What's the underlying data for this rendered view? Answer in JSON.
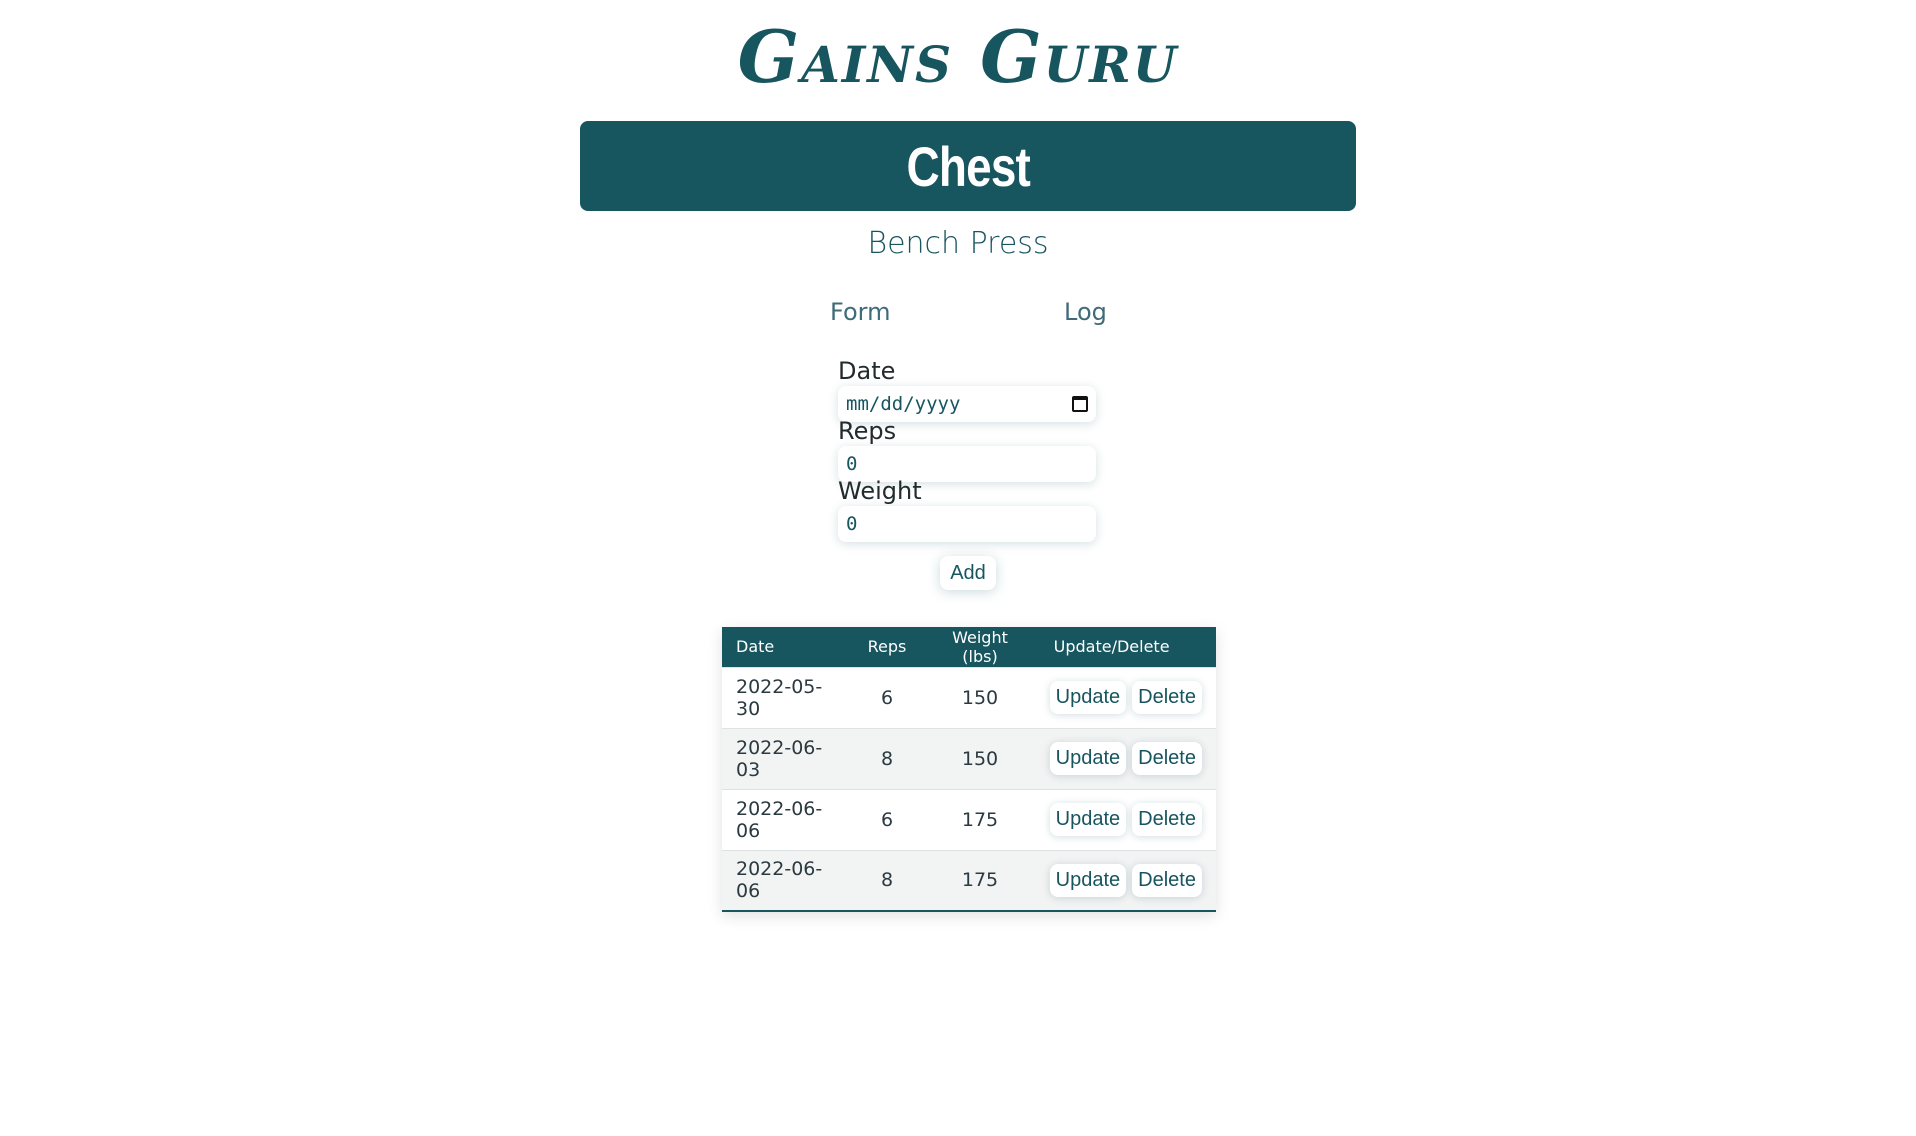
{
  "app": {
    "title": "Gains Guru"
  },
  "category": {
    "title": "Chest"
  },
  "exercise": {
    "name": "Bench Press"
  },
  "tabs": [
    {
      "label": "Form"
    },
    {
      "label": "Log"
    }
  ],
  "form": {
    "date": {
      "label": "Date",
      "value": "mm/dd/yyyy"
    },
    "reps": {
      "label": "Reps",
      "value": "0"
    },
    "weight": {
      "label": "Weight",
      "value": "0"
    },
    "add_label": "Add"
  },
  "table": {
    "headers": [
      "Date",
      "Reps",
      "Weight (lbs)",
      "Update/Delete"
    ],
    "update_label": "Update",
    "delete_label": "Delete",
    "rows": [
      {
        "date": "2022-05-30",
        "reps": "6",
        "weight": "150"
      },
      {
        "date": "2022-06-03",
        "reps": "8",
        "weight": "150"
      },
      {
        "date": "2022-06-06",
        "reps": "6",
        "weight": "175"
      },
      {
        "date": "2022-06-06",
        "reps": "8",
        "weight": "175"
      }
    ]
  },
  "colors": {
    "brand": "#17555f",
    "text": "#2b3a40"
  },
  "icons": {
    "date_picker": "calendar-icon"
  }
}
